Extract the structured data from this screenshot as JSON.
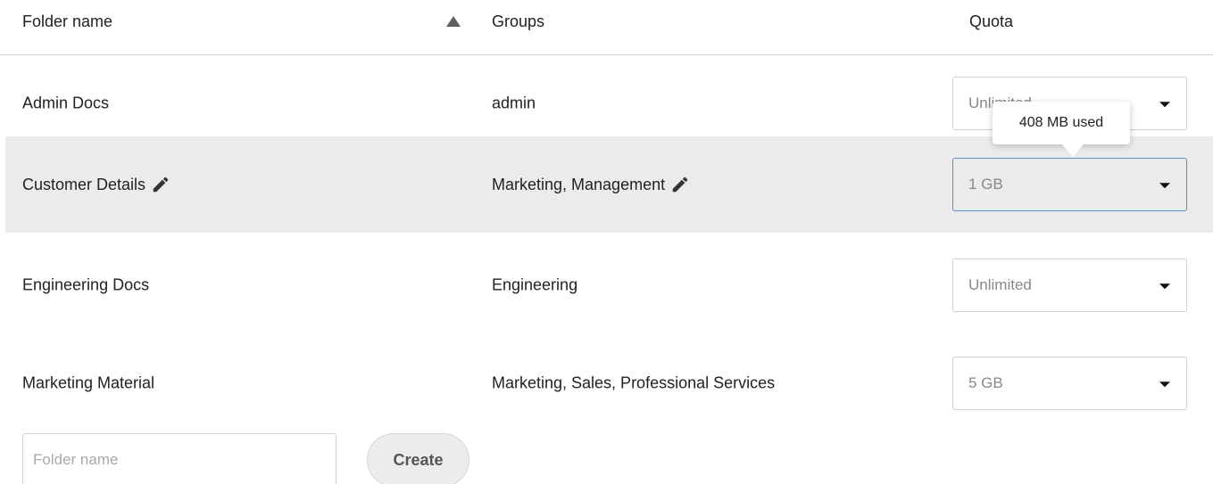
{
  "table": {
    "headers": {
      "folder_name": "Folder name",
      "groups": "Groups",
      "quota": "Quota"
    },
    "sort": {
      "column": "folder_name",
      "direction": "ascending",
      "icon": "sort-ascending-icon"
    },
    "rows": [
      {
        "folder": "Admin Docs",
        "groups": "admin",
        "quota": "Unlimited",
        "editable": false
      },
      {
        "folder": "Customer Details",
        "groups": "Marketing, Management",
        "quota": "1 GB",
        "editable": true,
        "highlighted": true
      },
      {
        "folder": "Engineering Docs",
        "groups": "Engineering",
        "quota": "Unlimited",
        "editable": false
      },
      {
        "folder": "Marketing Material",
        "groups": "Marketing, Sales, Professional Services",
        "quota": "5 GB",
        "editable": false
      }
    ]
  },
  "tooltip": {
    "text": "408 MB used"
  },
  "new_folder": {
    "placeholder": "Folder name",
    "value": "",
    "create_label": "Create"
  },
  "colors": {
    "highlight_row": "#ebebeb",
    "focus_border": "#5b8fc9",
    "text": "#222222"
  }
}
